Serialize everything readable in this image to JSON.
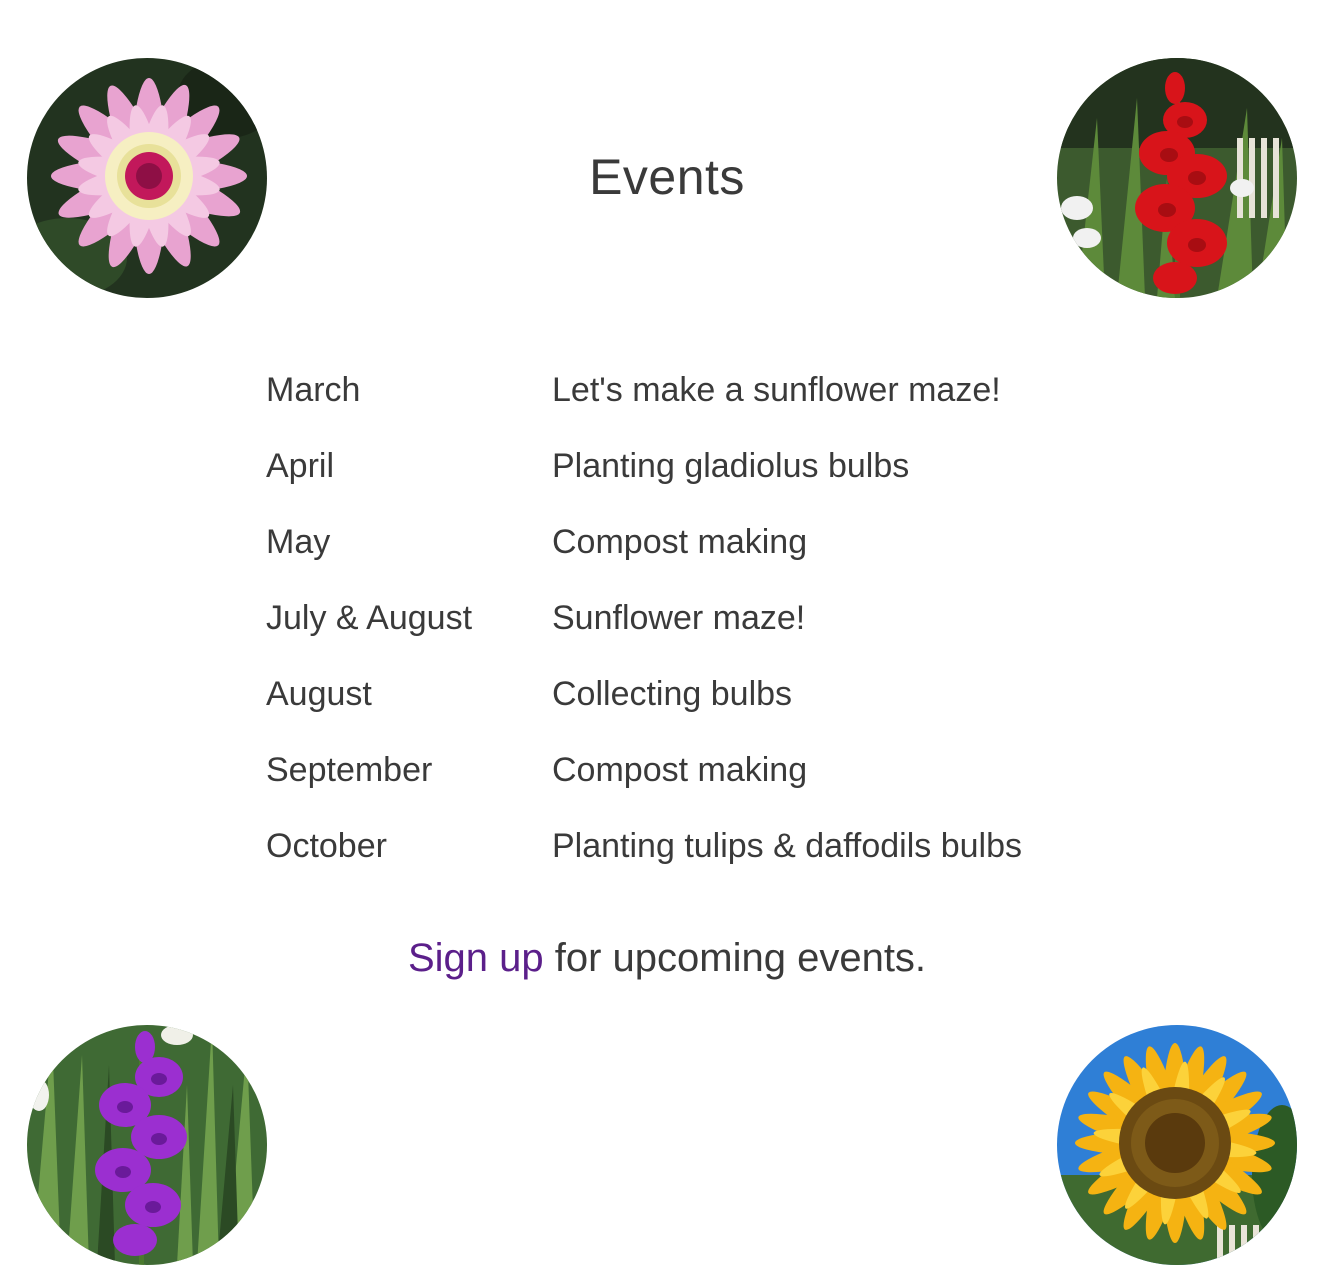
{
  "page": {
    "title": "Events"
  },
  "events": [
    {
      "month": "March",
      "description": "Let's make a sunflower maze!"
    },
    {
      "month": "April",
      "description": "Planting gladiolus bulbs"
    },
    {
      "month": "May",
      "description": "Compost making"
    },
    {
      "month": "July & August",
      "description": "Sunflower maze!"
    },
    {
      "month": "August",
      "description": "Collecting bulbs"
    },
    {
      "month": "September",
      "description": "Compost making"
    },
    {
      "month": "October",
      "description": "Planting tulips & daffodils bulbs"
    }
  ],
  "signup": {
    "link_text": "Sign up",
    "rest_text": " for upcoming events."
  },
  "images": [
    {
      "name": "pink-dahlia-photo"
    },
    {
      "name": "red-gladiolus-photo"
    },
    {
      "name": "purple-gladiolus-photo"
    },
    {
      "name": "sunflower-photo"
    }
  ],
  "colors": {
    "text": "#3a3a3a",
    "link": "#5b1f8a",
    "background": "#ffffff"
  }
}
